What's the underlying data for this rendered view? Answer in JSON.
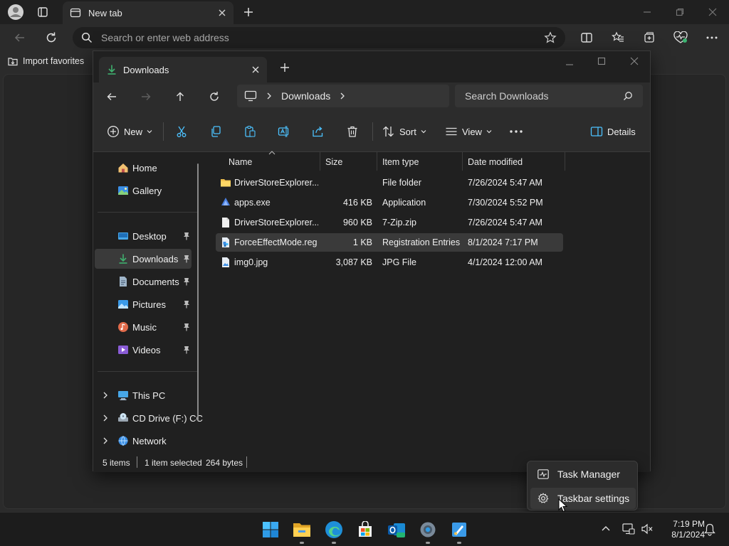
{
  "browser": {
    "tab_title": "New tab",
    "address_placeholder": "Search or enter web address",
    "favorites_import": "Import favorites"
  },
  "explorer": {
    "tab_title": "Downloads",
    "breadcrumb": "Downloads",
    "search_placeholder": "Search Downloads",
    "commands": {
      "new": "New",
      "sort": "Sort",
      "view": "View",
      "details": "Details"
    },
    "sidebar": {
      "top": [
        {
          "label": "Home",
          "icon": "home-icon"
        },
        {
          "label": "Gallery",
          "icon": "gallery-icon"
        }
      ],
      "pinned": [
        {
          "label": "Desktop",
          "icon": "desktop-folder-icon"
        },
        {
          "label": "Downloads",
          "icon": "downloads-folder-icon"
        },
        {
          "label": "Documents",
          "icon": "documents-folder-icon"
        },
        {
          "label": "Pictures",
          "icon": "pictures-folder-icon"
        },
        {
          "label": "Music",
          "icon": "music-folder-icon"
        },
        {
          "label": "Videos",
          "icon": "videos-folder-icon"
        }
      ],
      "drives": [
        {
          "label": "This PC",
          "icon": "this-pc-icon"
        },
        {
          "label": "CD Drive (F:) CC",
          "icon": "cd-drive-icon"
        },
        {
          "label": "Network",
          "icon": "network-icon"
        }
      ],
      "selected": "Downloads"
    },
    "columns": {
      "name": "Name",
      "size": "Size",
      "type": "Item type",
      "date": "Date modified"
    },
    "files": [
      {
        "name": "DriverStoreExplorer....",
        "size": "",
        "type": "File folder",
        "date": "7/26/2024 5:47 AM",
        "icon": "folder-icon"
      },
      {
        "name": "apps.exe",
        "size": "416 KB",
        "type": "Application",
        "date": "7/30/2024 5:52 PM",
        "icon": "exe-icon"
      },
      {
        "name": "DriverStoreExplorer....",
        "size": "960 KB",
        "type": "7-Zip.zip",
        "date": "7/26/2024 5:47 AM",
        "icon": "zip-file-icon"
      },
      {
        "name": "ForceEffectMode.reg",
        "size": "1 KB",
        "type": "Registration Entries",
        "date": "8/1/2024 7:17 PM",
        "icon": "reg-file-icon"
      },
      {
        "name": "img0.jpg",
        "size": "3,087 KB",
        "type": "JPG File",
        "date": "4/1/2024 12:00 AM",
        "icon": "image-file-icon"
      }
    ],
    "selected_file": "ForceEffectMode.reg",
    "status": {
      "items": "5 items",
      "selection": "1 item selected",
      "bytes": "264 bytes"
    }
  },
  "context_menu": {
    "items": [
      {
        "label": "Task Manager",
        "icon": "task-manager-icon"
      },
      {
        "label": "Taskbar settings",
        "icon": "settings-gear-icon"
      }
    ]
  },
  "taskbar": {
    "apps": [
      "start-icon",
      "file-explorer-icon",
      "edge-icon",
      "store-icon",
      "outlook-icon",
      "settings-icon",
      "paint-icon"
    ],
    "time": "7:19 PM",
    "date": "8/1/2024"
  }
}
